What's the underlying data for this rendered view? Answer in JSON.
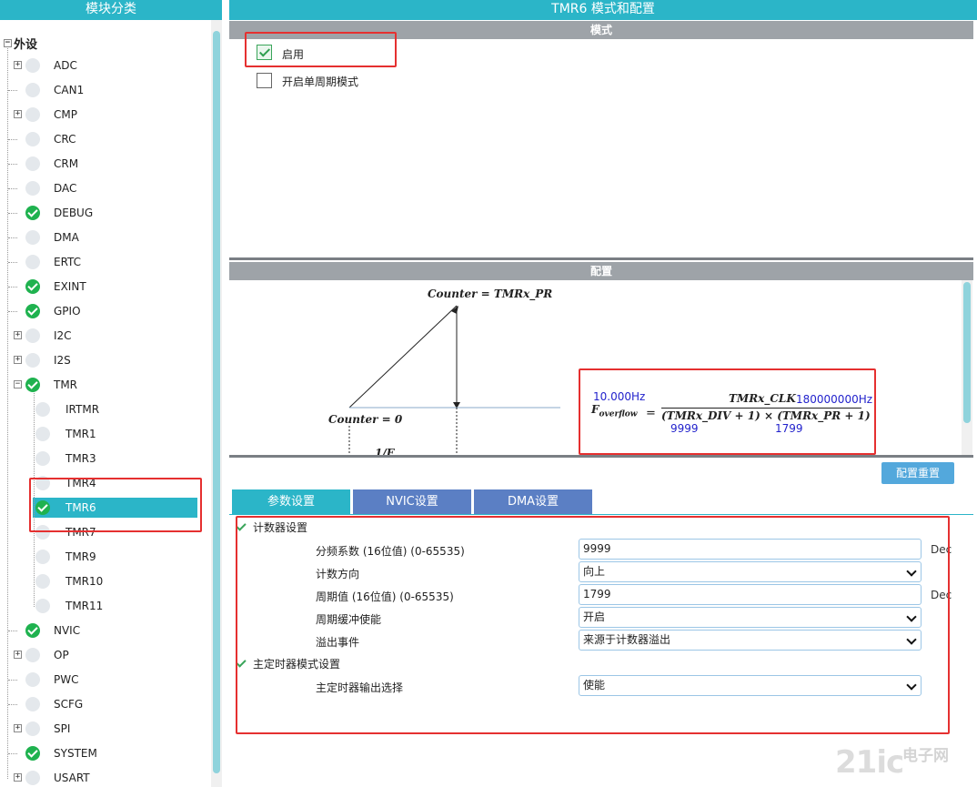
{
  "left_panel": {
    "title": "模块分类",
    "root_label": "外设",
    "items": [
      {
        "label": "ADC",
        "expandable": true,
        "status": "none"
      },
      {
        "label": "CAN1",
        "expandable": false,
        "status": "none"
      },
      {
        "label": "CMP",
        "expandable": true,
        "status": "none"
      },
      {
        "label": "CRC",
        "expandable": false,
        "status": "none"
      },
      {
        "label": "CRM",
        "expandable": false,
        "status": "none"
      },
      {
        "label": "DAC",
        "expandable": false,
        "status": "none"
      },
      {
        "label": "DEBUG",
        "expandable": false,
        "status": "ok"
      },
      {
        "label": "DMA",
        "expandable": false,
        "status": "none"
      },
      {
        "label": "ERTC",
        "expandable": false,
        "status": "none"
      },
      {
        "label": "EXINT",
        "expandable": false,
        "status": "ok"
      },
      {
        "label": "GPIO",
        "expandable": false,
        "status": "ok"
      },
      {
        "label": "I2C",
        "expandable": true,
        "status": "none"
      },
      {
        "label": "I2S",
        "expandable": true,
        "status": "none"
      },
      {
        "label": "TMR",
        "expandable": true,
        "expanded": true,
        "status": "ok"
      },
      {
        "label": "IRTMR",
        "child": true,
        "status": "none"
      },
      {
        "label": "TMR1",
        "child": true,
        "status": "none"
      },
      {
        "label": "TMR3",
        "child": true,
        "status": "none"
      },
      {
        "label": "TMR4",
        "child": true,
        "status": "none"
      },
      {
        "label": "TMR6",
        "child": true,
        "status": "ok",
        "selected": true
      },
      {
        "label": "TMR7",
        "child": true,
        "status": "none"
      },
      {
        "label": "TMR9",
        "child": true,
        "status": "none"
      },
      {
        "label": "TMR10",
        "child": true,
        "status": "none"
      },
      {
        "label": "TMR11",
        "child": true,
        "status": "none"
      },
      {
        "label": "NVIC",
        "expandable": false,
        "status": "ok"
      },
      {
        "label": "OP",
        "expandable": true,
        "status": "none"
      },
      {
        "label": "PWC",
        "expandable": false,
        "status": "none"
      },
      {
        "label": "SCFG",
        "expandable": false,
        "status": "none"
      },
      {
        "label": "SPI",
        "expandable": true,
        "status": "none"
      },
      {
        "label": "SYSTEM",
        "expandable": false,
        "status": "ok"
      },
      {
        "label": "USART",
        "expandable": true,
        "status": "none"
      }
    ]
  },
  "right_panel": {
    "title": "TMR6 模式和配置",
    "mode_section": {
      "title": "模式",
      "enable_label": "启用",
      "enable_checked": true,
      "one_pulse_label": "开启单周期模式",
      "one_pulse_checked": false
    },
    "config_section": {
      "title": "配置",
      "diagram": {
        "top_label": "Counter = TMRx_PR",
        "bottom_label": "Counter = 0",
        "partial_label": "1/F"
      },
      "formula": {
        "result_value": "10.000Hz",
        "lhs_main": "F",
        "lhs_sub": "overflow",
        "equals": "=",
        "numerator": "TMRx_CLK",
        "clk_value": "180000000Hz",
        "denominator": "(TMRx_DIV + 1) × (TMRx_PR + 1)",
        "div_value": "9999",
        "pr_value": "1799"
      }
    },
    "reset_button": "配置重置",
    "tabs": [
      {
        "label": "参数设置",
        "active": true
      },
      {
        "label": "NVIC设置",
        "active": false
      },
      {
        "label": "DMA设置",
        "active": false
      }
    ],
    "groups": [
      {
        "label": "计数器设置",
        "params": [
          {
            "label": "分频系数 (16位值) (0-65535)",
            "type": "input",
            "value": "9999",
            "unit": "Dec"
          },
          {
            "label": "计数方向",
            "type": "select",
            "value": "向上"
          },
          {
            "label": "周期值 (16位值) (0-65535)",
            "type": "input",
            "value": "1799",
            "unit": "Dec"
          },
          {
            "label": "周期缓冲使能",
            "type": "select",
            "value": "开启"
          },
          {
            "label": "溢出事件",
            "type": "select",
            "value": "来源于计数器溢出"
          }
        ]
      },
      {
        "label": "主定时器模式设置",
        "params": [
          {
            "label": "主定时器输出选择",
            "type": "select",
            "value": "使能"
          }
        ]
      }
    ]
  },
  "watermark": {
    "logo": "21ic",
    "text": "电子网"
  },
  "colors": {
    "header": "#2bb5c8",
    "tab_inactive": "#5b7fc4",
    "ok": "#1fb24f",
    "highlight": "#e53030",
    "button": "#53a8dc"
  }
}
